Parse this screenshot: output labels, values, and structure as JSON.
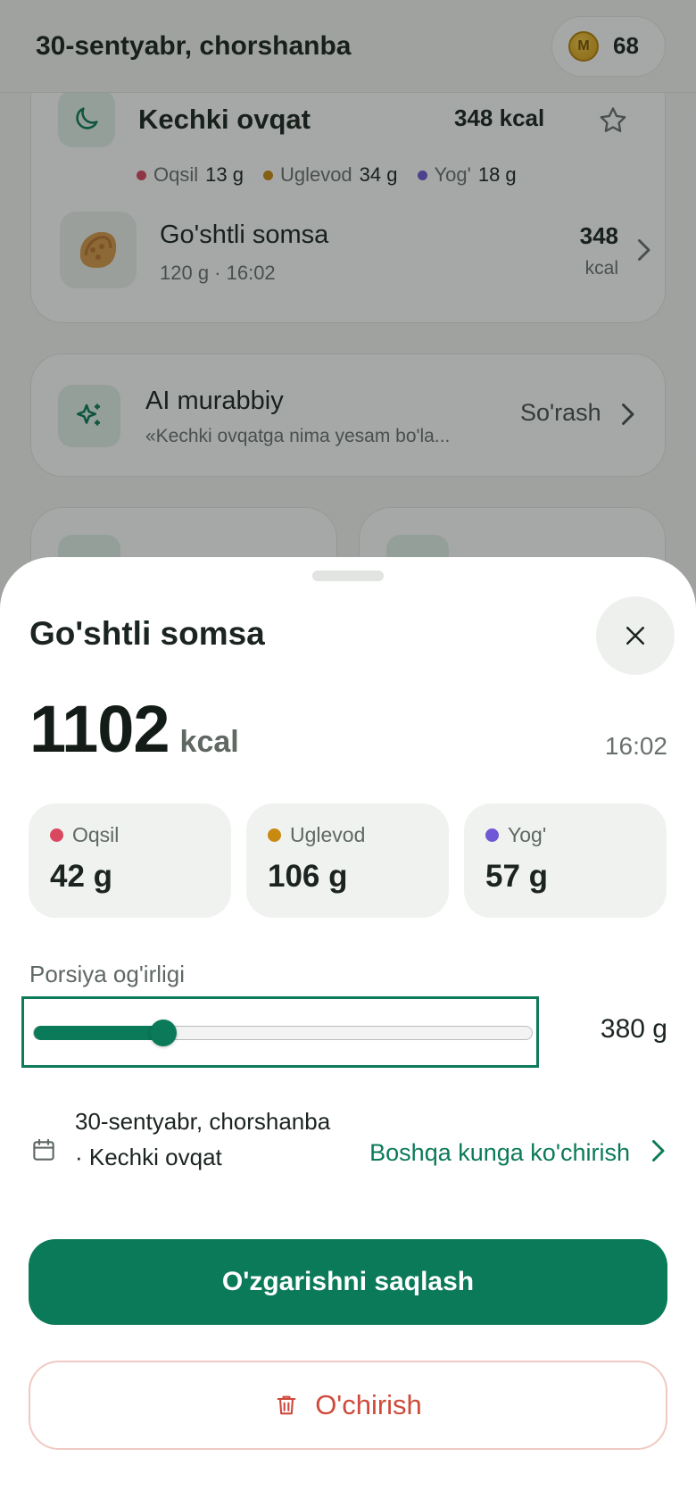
{
  "header": {
    "date": "30-sentyabr, chorshanba",
    "coins": "68",
    "coin_letter": "M"
  },
  "meal_card": {
    "title": "Kechki ovqat",
    "kcal": "348 kcal",
    "macros": [
      {
        "label": "Oqsil",
        "value": "13 g",
        "color": "#d9485f"
      },
      {
        "label": "Uglevod",
        "value": "34 g",
        "color": "#c98a12"
      },
      {
        "label": "Yog'",
        "value": "18 g",
        "color": "#7057d6"
      }
    ],
    "food": {
      "name": "Go'shtli somsa",
      "meta": "120 g · 16:02",
      "kcal_num": "348",
      "kcal_unit": "kcal"
    }
  },
  "ai_card": {
    "title": "AI murabbiy",
    "subtitle": "«Kechki ovqatga nima yesam bo'la...",
    "action": "So'rash"
  },
  "sheet": {
    "title": "Go'shtli somsa",
    "kcal_value": "1102",
    "kcal_unit": "kcal",
    "time": "16:02",
    "macros": [
      {
        "label": "Oqsil",
        "value": "42 g",
        "color": "#d9485f"
      },
      {
        "label": "Uglevod",
        "value": "106 g",
        "color": "#c98a12"
      },
      {
        "label": "Yog'",
        "value": "57 g",
        "color": "#7057d6"
      }
    ],
    "portion": {
      "label": "Porsiya og'irligi",
      "value": "380 g",
      "fraction": 0.26
    },
    "date_text": "30-sentyabr, chorshanba · Kechki ovqat",
    "move_link": "Boshqa kunga ko'chirish",
    "save_label": "O'zgarishni saqlash",
    "delete_label": "O'chirish"
  },
  "colors": {
    "accent": "#0b7a58",
    "danger": "#cf4a3b"
  },
  "icons": [
    "moon-icon",
    "star-icon",
    "sparkles-icon",
    "chevron-right-icon",
    "close-icon",
    "calendar-icon",
    "trash-icon",
    "coin-icon"
  ]
}
